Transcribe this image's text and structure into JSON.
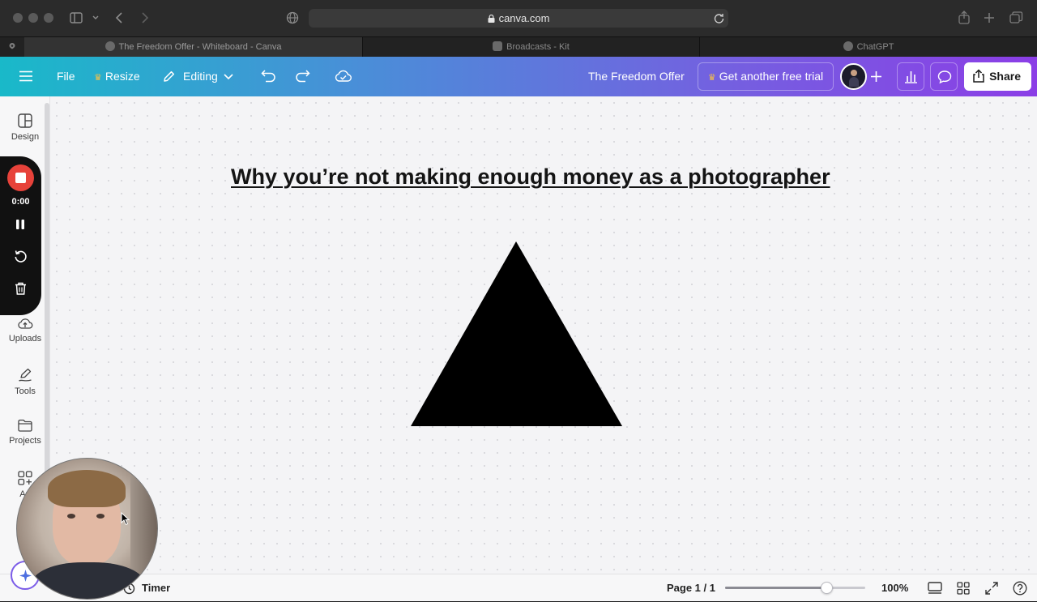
{
  "browser": {
    "url": "canva.com",
    "tabs": [
      {
        "title": "The Freedom Offer - Whiteboard - Canva",
        "active": true
      },
      {
        "title": "Broadcasts - Kit",
        "active": false
      },
      {
        "title": "ChatGPT",
        "active": false
      }
    ]
  },
  "header": {
    "file_label": "File",
    "resize_label": "Resize",
    "mode_label": "Editing",
    "doc_name": "The Freedom Offer",
    "trial_label": "Get another free trial",
    "share_label": "Share"
  },
  "sidebar": {
    "items": [
      {
        "label": "Design",
        "icon": "layout-icon"
      },
      {
        "label": "Uploads",
        "icon": "cloud-upload-icon"
      },
      {
        "label": "Tools",
        "icon": "pen-icon"
      },
      {
        "label": "Projects",
        "icon": "folder-icon"
      },
      {
        "label": "Ap",
        "icon": "apps-icon"
      }
    ]
  },
  "recorder": {
    "time": "0:00"
  },
  "canvas": {
    "title": "Why you’re not making enough money as a photographer",
    "shape": "triangle"
  },
  "footer": {
    "timer_label": "Timer",
    "page_label": "Page 1 / 1",
    "zoom_label": "100%",
    "zoom_level": 0.72
  },
  "colors": {
    "header_gradient_start": "#19b9c9",
    "header_gradient_end": "#8b3ee6",
    "record": "#e7423a",
    "crown": "#f7c046"
  }
}
